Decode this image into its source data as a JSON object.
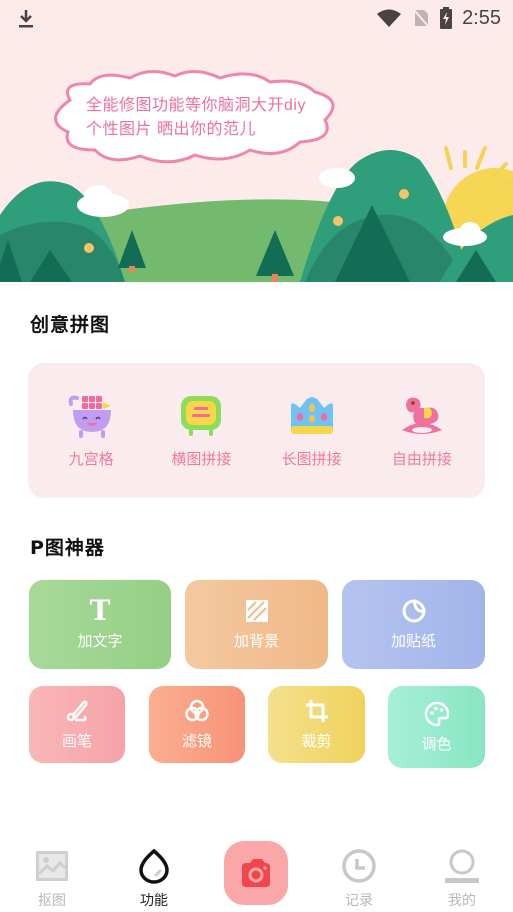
{
  "status_bar": {
    "time": "2:55",
    "icons": [
      "download-icon",
      "wifi-icon",
      "no-sim-icon",
      "battery-charging-icon"
    ]
  },
  "banner": {
    "line1": "全能修图功能等你脑洞大开diy",
    "line2": "个性图片 晒出你的范儿"
  },
  "collage_section": {
    "title": "创意拼图",
    "items": [
      {
        "label": "九宫格",
        "icon": "cart-grid-icon"
      },
      {
        "label": "横图拼接",
        "icon": "tv-icon"
      },
      {
        "label": "长图拼接",
        "icon": "crown-icon"
      },
      {
        "label": "自由拼接",
        "icon": "rocking-horse-icon"
      }
    ]
  },
  "tools_section": {
    "title": "P图神器",
    "row1": [
      {
        "label": "加文字",
        "icon": "text-icon",
        "colors": [
          "#a8d99a",
          "#94cf84"
        ]
      },
      {
        "label": "加背景",
        "icon": "background-icon",
        "colors": [
          "#f4c9a0",
          "#f0b888"
        ]
      },
      {
        "label": "加贴纸",
        "icon": "sticker-icon",
        "colors": [
          "#b5c3ef",
          "#a2b4ea"
        ]
      }
    ],
    "row2": [
      {
        "label": "画笔",
        "icon": "brush-icon",
        "colors": [
          "#f9b7b7",
          "#f6a3a8"
        ]
      },
      {
        "label": "滤镜",
        "icon": "filter-icon",
        "colors": [
          "#fbae90",
          "#f79277"
        ]
      },
      {
        "label": "裁剪",
        "icon": "crop-icon",
        "colors": [
          "#f5e08c",
          "#efd25e"
        ]
      },
      {
        "label": "调色",
        "icon": "palette-icon",
        "colors": [
          "#a8efd7",
          "#88e5c3"
        ]
      }
    ]
  },
  "bottom_nav": {
    "items": [
      {
        "label": "抠图",
        "icon": "image-icon",
        "active": false
      },
      {
        "label": "功能",
        "icon": "egg-icon",
        "active": true
      },
      {
        "label": "",
        "icon": "camera-icon",
        "active": false
      },
      {
        "label": "记录",
        "icon": "clock-icon",
        "active": false
      },
      {
        "label": "我的",
        "icon": "user-icon",
        "active": false
      }
    ]
  }
}
